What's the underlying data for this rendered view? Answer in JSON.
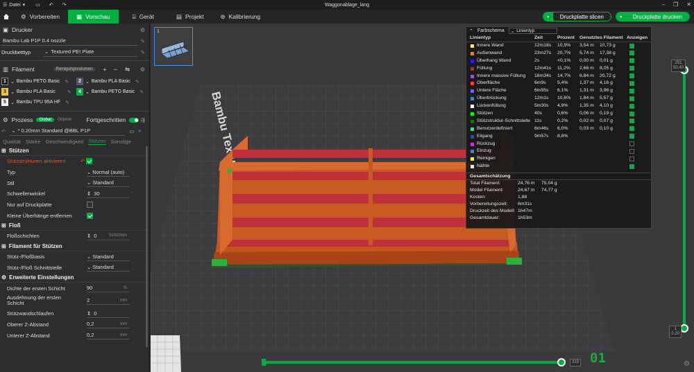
{
  "titlebar": {
    "menu_label": "Datei",
    "title": "Waggonablage_lang"
  },
  "toolbar": {
    "tabs": [
      {
        "label": "Vorbereiten"
      },
      {
        "label": "Vorschau"
      },
      {
        "label": "Gerät"
      },
      {
        "label": "Projekt"
      },
      {
        "label": "Kalibrierung"
      }
    ],
    "slice_button": "Druckplatte slicen",
    "print_button": "Druckplatte drucken"
  },
  "sidebar": {
    "printer_header": "Drucker",
    "printer_value": "Bambu Lab P1P 0.4 nozzle",
    "bed_label": "Druckbetttyp",
    "bed_value": "Textured PEI Plate",
    "filament_header": "Filament",
    "filament_pill": "Reinigungsvolumen",
    "filaments": [
      {
        "num": "1",
        "name": "Bambu PETG Basic",
        "color": "#1c1c1c",
        "text": "#ffffff"
      },
      {
        "num": "2",
        "name": "Bambu PLA Basic",
        "color": "#4a5a6a",
        "text": "#ffffff"
      },
      {
        "num": "3",
        "name": "Bambu PLA Basic",
        "color": "#f0c040",
        "text": "#1c1c1c"
      },
      {
        "num": "4",
        "name": "Bambu PETG Basic",
        "color": "#00ae42",
        "text": "#ffffff"
      },
      {
        "num": "5",
        "name": "Bambu TPU 95A HF",
        "color": "#f4f4f4",
        "text": "#1c1c1c"
      }
    ],
    "process_header": "Prozess",
    "process_global": "Global",
    "process_objects": "Objekte",
    "advanced_label": "Fortgeschritten",
    "process_value": "* 0.20mm Standard @BBL P1P",
    "subtabs": [
      "Qualität",
      "Stärke",
      "Geschwindigkeit",
      "Stützen",
      "Sonstige"
    ],
    "groups": {
      "support": "Stützen",
      "raft": "Floß",
      "support_filament": "Filament für Stützen",
      "advanced": "Erweiterte Einstellungen"
    },
    "params": {
      "enable_support": "Stützstrukturen aktivieren",
      "type_label": "Typ",
      "type_value": "Normal (auto)",
      "style_label": "Stil",
      "style_value": "Standard",
      "threshold_label": "Schwellenwinkel",
      "threshold_value": "30",
      "buildplate_only": "Nur auf Druckplatte",
      "remove_small": "Kleine Überhänge entfernen",
      "raft_layers_label": "Floßschichten",
      "raft_layers_value": "0",
      "raft_layers_unit": "Schichten",
      "base_label": "Stütz-/Floßbasis",
      "base_value": "Standard",
      "interface_label": "Stütz-/Floß Schnittstelle",
      "interface_value": "Standard",
      "first_density_label": "Dichte der ersten Schicht",
      "first_density_value": "90",
      "first_density_unit": "%",
      "first_expansion_label": "Ausdehnung der ersten Schicht",
      "first_expansion_value": "2",
      "first_expansion_unit": "mm",
      "wall_loops_label": "Stützwandschlaufen",
      "wall_loops_value": "0",
      "top_z_label": "Oberer Z-Abstand",
      "top_z_value": "0,2",
      "top_z_unit": "mm",
      "bottom_z_label": "Unterer Z-Abstand",
      "bottom_z_value": "0,2",
      "bottom_z_unit": "mm"
    }
  },
  "viewport": {
    "plate_number": "1",
    "plate_text": "Bambu Textured PEI Plate",
    "layer_top": "251",
    "layer_top_height": "50.40",
    "layer_bottom": "1",
    "layer_bottom_height": "0.20",
    "hslider_value": "319",
    "plate_index_badge": "01"
  },
  "legend": {
    "title": "Farbschema",
    "select_value": "Linientyp",
    "cols": [
      "Linientyp",
      "Zeit",
      "Prozent",
      "Genutztes Filament",
      "Anzeigen"
    ],
    "rows": [
      {
        "name": "Innere Wand",
        "color": "#ffe680",
        "time": "12m18s",
        "pct": "10,9%",
        "len": "3,54 m",
        "wt": "10,73 g",
        "show": true
      },
      {
        "name": "Außenwand",
        "color": "#ff7f00",
        "time": "23m27s",
        "pct": "20,7%",
        "len": "5,74 m",
        "wt": "17,38 g",
        "show": true
      },
      {
        "name": "Überhang Wand",
        "color": "#2020ff",
        "time": "2s",
        "pct": "<0,1%",
        "len": "0,00 m",
        "wt": "0,01 g",
        "show": true
      },
      {
        "name": "Füllung",
        "color": "#b03029",
        "time": "12m41s",
        "pct": "11,2%",
        "len": "2,66 m",
        "wt": "8,05 g",
        "show": true
      },
      {
        "name": "Innere massive Füllung",
        "color": "#9654cc",
        "time": "16m34s",
        "pct": "14,7%",
        "len": "6,84 m",
        "wt": "20,72 g",
        "show": true
      },
      {
        "name": "Oberfläche",
        "color": "#f04040",
        "time": "6m9s",
        "pct": "5,4%",
        "len": "1,37 m",
        "wt": "4,16 g",
        "show": true
      },
      {
        "name": "Untere Fläche",
        "color": "#6666ff",
        "time": "6m55s",
        "pct": "6,1%",
        "len": "1,31 m",
        "wt": "3,96 g",
        "show": true
      },
      {
        "name": "Überbrückung",
        "color": "#4d80ba",
        "time": "12m1s",
        "pct": "10,6%",
        "len": "1,84 m",
        "wt": "5,57 g",
        "show": true
      },
      {
        "name": "Lückenfüllung",
        "color": "#ffffff",
        "time": "5m30s",
        "pct": "4,9%",
        "len": "1,35 m",
        "wt": "4,10 g",
        "show": true
      },
      {
        "name": "Stützen",
        "color": "#00ff00",
        "time": "40s",
        "pct": "0,6%",
        "len": "0,06 m",
        "wt": "0,19 g",
        "show": true
      },
      {
        "name": "Stützstruktur-Schnittstelle",
        "color": "#008000",
        "time": "11s",
        "pct": "0,2%",
        "len": "0,02 m",
        "wt": "0,07 g",
        "show": true
      },
      {
        "name": "Benutzerdefiniert",
        "color": "#5ed194",
        "time": "6m46s",
        "pct": "6,0%",
        "len": "0,03 m",
        "wt": "0,10 g",
        "show": true
      },
      {
        "name": "Eilgang",
        "color": "#38489c",
        "time": "9m57s",
        "pct": "8,8%",
        "len": "",
        "wt": "",
        "show": true
      },
      {
        "name": "Rückzug",
        "color": "#cc33cc",
        "time": "",
        "pct": "",
        "len": "",
        "wt": "",
        "show": false
      },
      {
        "name": "Einzug",
        "color": "#4d80ba",
        "time": "",
        "pct": "",
        "len": "",
        "wt": "",
        "show": false
      },
      {
        "name": "Reinigen",
        "color": "#ffff00",
        "time": "",
        "pct": "",
        "len": "",
        "wt": "",
        "show": false
      },
      {
        "name": "Nähte",
        "color": "#e6e6e6",
        "time": "",
        "pct": "",
        "len": "",
        "wt": "",
        "show": true
      }
    ],
    "summary_title": "Gesamtschätzung",
    "summary": [
      {
        "label": "Total Filament:",
        "v1": "24,76 m",
        "v2": "75,04 g"
      },
      {
        "label": "Model Filament:",
        "v1": "24,67 m",
        "v2": "74,77 g"
      },
      {
        "label": "Kosten:",
        "v1": "1,88",
        "v2": ""
      },
      {
        "label": "Vorbereitungszeit:",
        "v1": "6m31s",
        "v2": ""
      },
      {
        "label": "Druckzeit des Modell:",
        "v1": "1h47m",
        "v2": ""
      },
      {
        "label": "Gesamtdauer:",
        "v1": "1h53m",
        "v2": ""
      }
    ]
  },
  "colors": {
    "accent": "#00ae42",
    "model_orange": "#d2622a",
    "model_red": "#c0303a"
  }
}
